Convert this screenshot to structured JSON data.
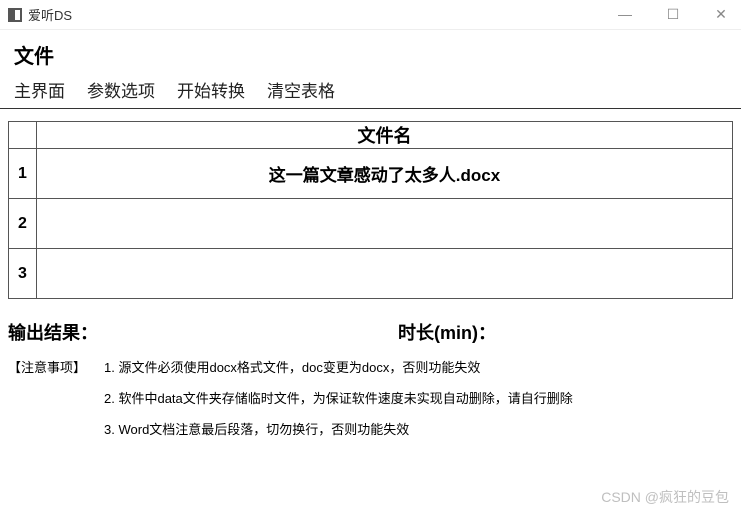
{
  "window": {
    "title": "爱听DS",
    "minimize": "—",
    "maximize": "☐",
    "close": "✕"
  },
  "section_title": "文件",
  "menu": {
    "main": "主界面",
    "options": "参数选项",
    "start": "开始转换",
    "clear": "清空表格"
  },
  "table": {
    "header": "文件名",
    "rows": [
      {
        "num": "1",
        "filename": "这一篇文章感动了太多人.docx"
      },
      {
        "num": "2",
        "filename": ""
      },
      {
        "num": "3",
        "filename": ""
      }
    ]
  },
  "output": {
    "result_label": "输出结果：",
    "duration_label": "时长(min)："
  },
  "notes": {
    "label": "【注意事项】",
    "items": [
      "1. 源文件必须使用docx格式文件，doc变更为docx，否则功能失效",
      "2. 软件中data文件夹存储临时文件，为保证软件速度未实现自动删除，请自行删除",
      "3. Word文档注意最后段落，切勿换行，否则功能失效"
    ]
  },
  "watermark": "CSDN @疯狂的豆包"
}
